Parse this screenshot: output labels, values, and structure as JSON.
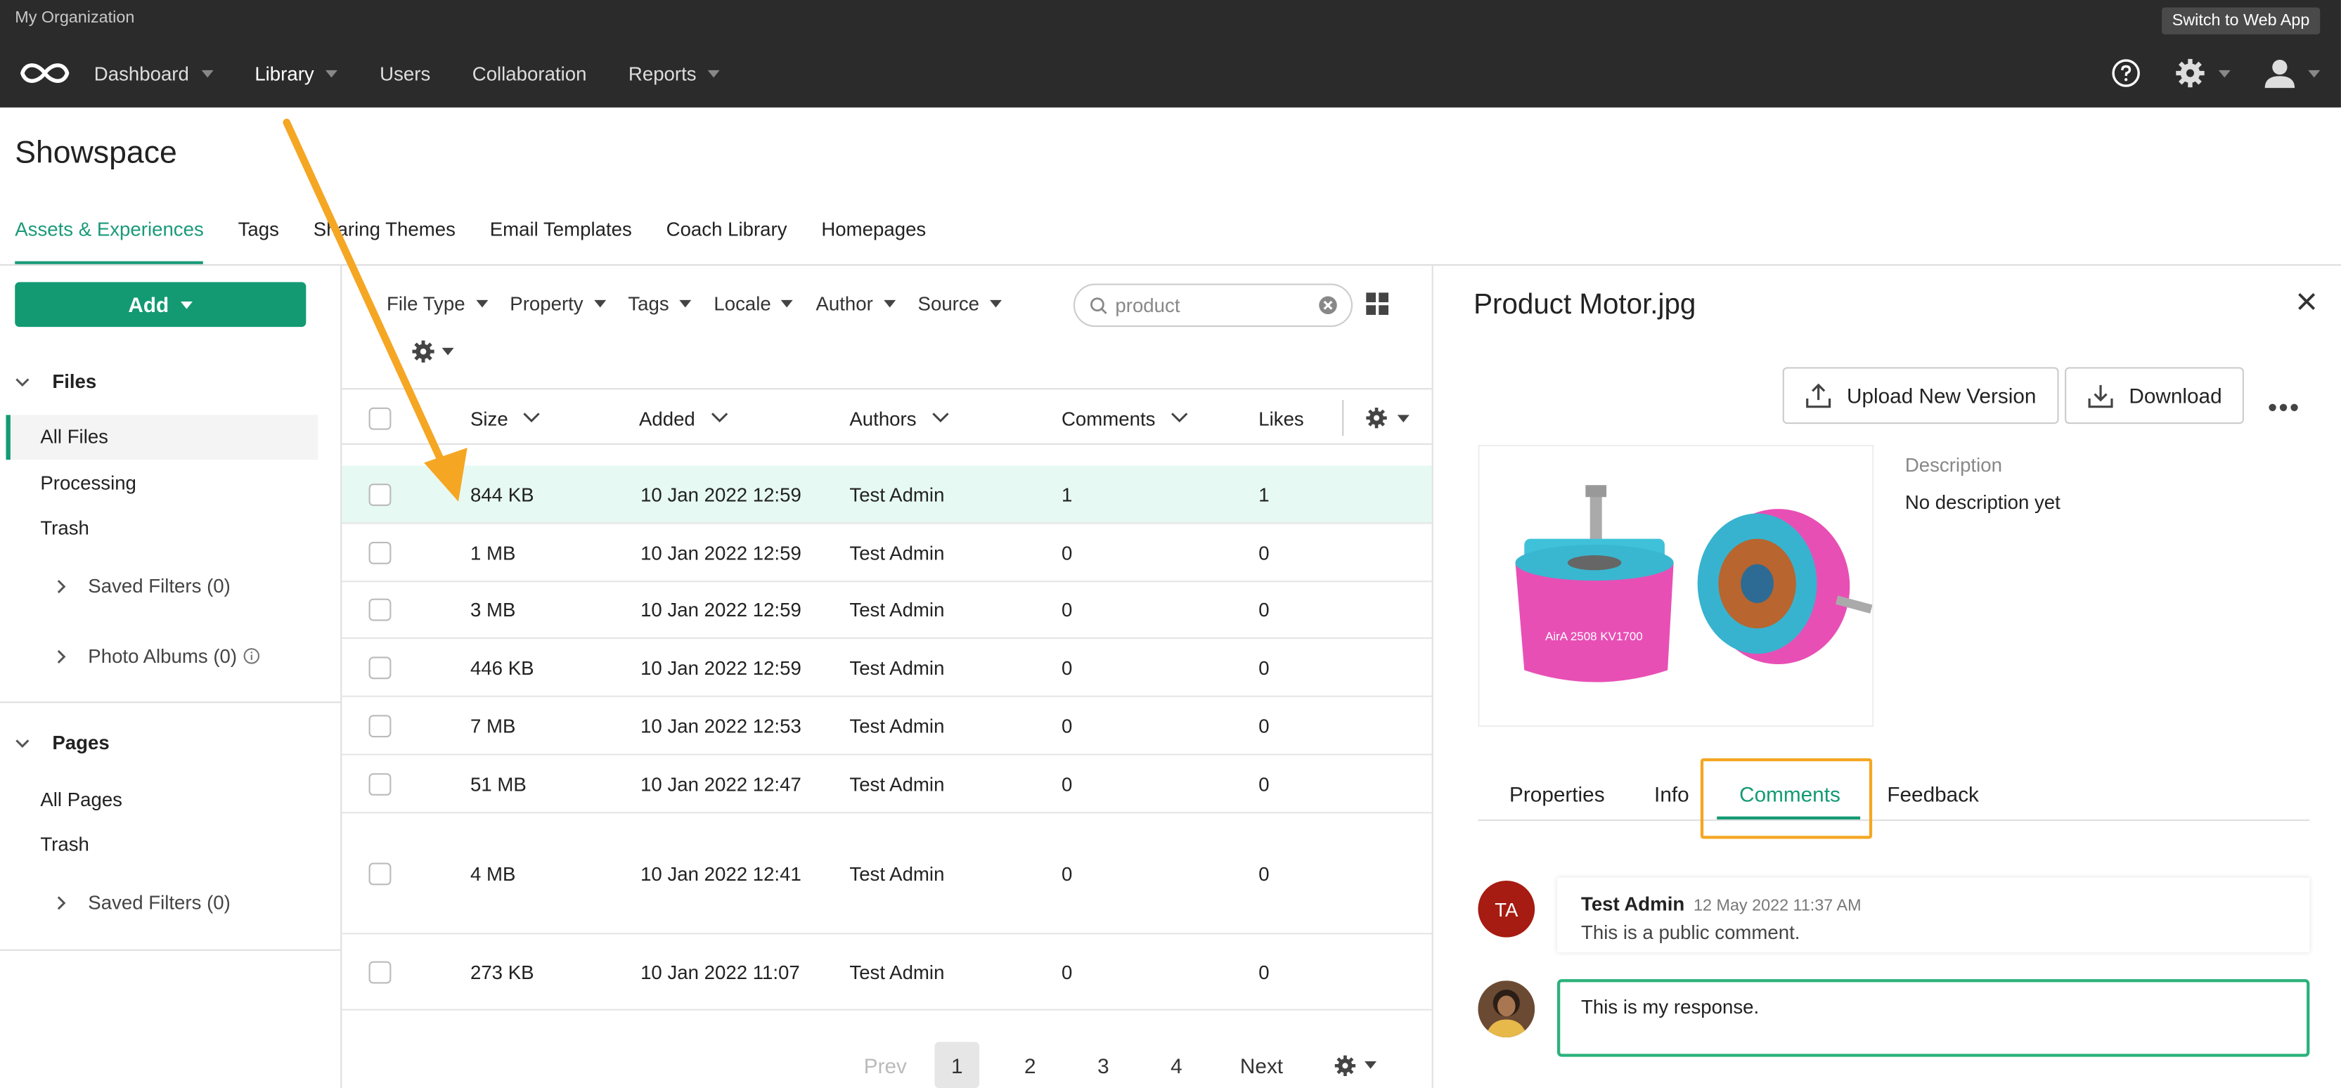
{
  "topbar": {
    "org": "My Organization",
    "switch_label": "Switch to Web App",
    "nav": [
      {
        "label": "Dashboard",
        "dropdown": true
      },
      {
        "label": "Library",
        "dropdown": true
      },
      {
        "label": "Users",
        "dropdown": false
      },
      {
        "label": "Collaboration",
        "dropdown": false
      },
      {
        "label": "Reports",
        "dropdown": true
      }
    ],
    "icons": [
      "help-icon",
      "gear-icon",
      "user-icon"
    ]
  },
  "page": {
    "title": "Showspace",
    "tabs": [
      "Assets & Experiences",
      "Tags",
      "Sharing Themes",
      "Email Templates",
      "Coach Library",
      "Homepages"
    ],
    "active_tab": "Assets & Experiences"
  },
  "sidebar": {
    "add_label": "Add",
    "files_header": "Files",
    "files_items": [
      "All Files",
      "Processing",
      "Trash"
    ],
    "files_saved_filters": "Saved Filters (0)",
    "photo_albums": "Photo Albums (0)",
    "pages_header": "Pages",
    "pages_items": [
      "All Pages",
      "Trash"
    ],
    "pages_saved_filters": "Saved Filters (0)"
  },
  "filters": {
    "items": [
      "File Type",
      "Property",
      "Tags",
      "Locale",
      "Author",
      "Source"
    ],
    "search_value": "product"
  },
  "table": {
    "headers": {
      "size": "Size",
      "added": "Added",
      "authors": "Authors",
      "comments": "Comments",
      "likes": "Likes"
    },
    "rows": [
      {
        "size": "844 KB",
        "added": "10 Jan 2022 12:59",
        "author": "Test Admin",
        "comments": "1",
        "likes": "1"
      },
      {
        "size": "1 MB",
        "added": "10 Jan 2022 12:59",
        "author": "Test Admin",
        "comments": "0",
        "likes": "0"
      },
      {
        "size": "3 MB",
        "added": "10 Jan 2022 12:59",
        "author": "Test Admin",
        "comments": "0",
        "likes": "0"
      },
      {
        "size": "446 KB",
        "added": "10 Jan 2022 12:59",
        "author": "Test Admin",
        "comments": "0",
        "likes": "0"
      },
      {
        "size": "7 MB",
        "added": "10 Jan 2022 12:53",
        "author": "Test Admin",
        "comments": "0",
        "likes": "0"
      },
      {
        "size": "51 MB",
        "added": "10 Jan 2022 12:47",
        "author": "Test Admin",
        "comments": "0",
        "likes": "0"
      },
      {
        "size": "4 MB",
        "added": "10 Jan 2022 12:41",
        "author": "Test Admin",
        "comments": "0",
        "likes": "0"
      },
      {
        "size": "273 KB",
        "added": "10 Jan 2022 11:07",
        "author": "Test Admin",
        "comments": "0",
        "likes": "0"
      }
    ]
  },
  "pager": {
    "prev": "Prev",
    "pages": [
      "1",
      "2",
      "3",
      "4"
    ],
    "current": "1",
    "next": "Next"
  },
  "detail": {
    "title": "Product Motor.jpg",
    "upload_label": "Upload New Version",
    "download_label": "Download",
    "description_label": "Description",
    "description_value": "No description yet",
    "preview_text": "AirA 2508 KV1700",
    "tabs": [
      "Properties",
      "Info",
      "Comments",
      "Feedback"
    ],
    "active_tab": "Comments",
    "comment": {
      "initials": "TA",
      "author": "Test Admin",
      "date": "12 May 2022 11:37 AM",
      "text": "This is a public comment."
    },
    "reply_value": "This is my response."
  },
  "colors": {
    "accent": "#139a73",
    "highlight": "#f5a623",
    "topbar": "#2b2b2b",
    "row_highlight": "#e6f9f3"
  }
}
